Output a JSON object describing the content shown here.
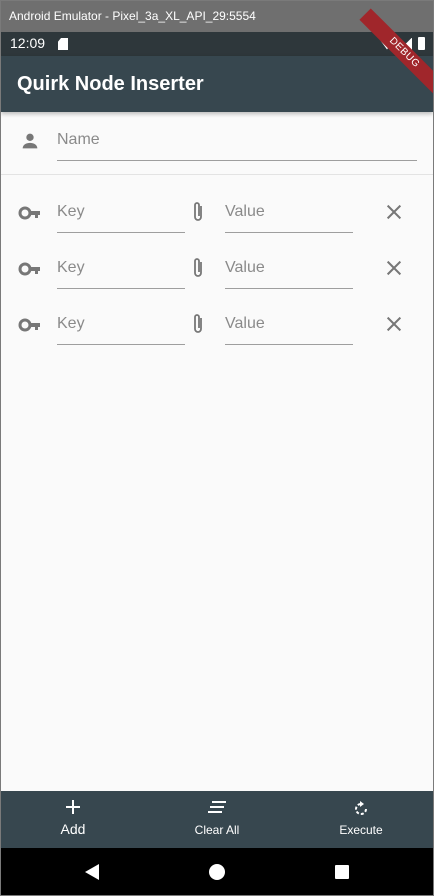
{
  "window": {
    "title": "Android Emulator - Pixel_3a_XL_API_29:5554"
  },
  "status_bar": {
    "time": "12:09"
  },
  "debug_banner": "DEBUG",
  "app_bar": {
    "title": "Quirk Node Inserter"
  },
  "name_field": {
    "placeholder": "Name",
    "icon": "person-icon"
  },
  "kv_rows": [
    {
      "key_placeholder": "Key",
      "value_placeholder": "Value"
    },
    {
      "key_placeholder": "Key",
      "value_placeholder": "Value"
    },
    {
      "key_placeholder": "Key",
      "value_placeholder": "Value"
    }
  ],
  "bottom_bar": {
    "add_label": "Add",
    "clear_label": "Clear All",
    "execute_label": "Execute"
  },
  "colors": {
    "app_bar": "#37474f",
    "status_bar": "#2e373b",
    "background": "#fafafa",
    "debug": "#a0262b"
  }
}
